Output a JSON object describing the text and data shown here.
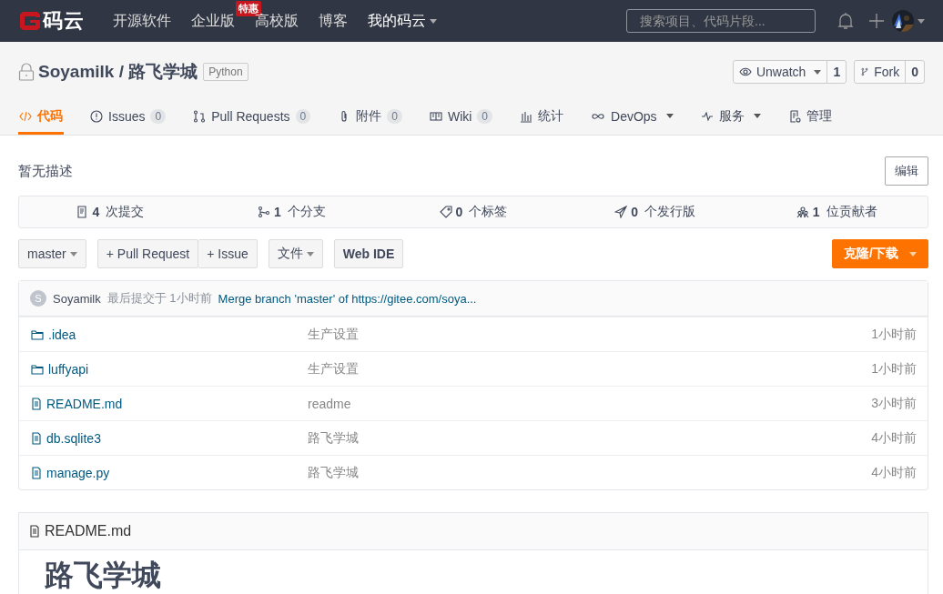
{
  "header": {
    "logo_text": "码云",
    "nav": [
      {
        "label": "开源软件"
      },
      {
        "label": "企业版",
        "badge": "特惠"
      },
      {
        "label": "高校版"
      },
      {
        "label": "博客"
      },
      {
        "label": "我的码云",
        "dropdown": true
      }
    ],
    "search": {
      "placeholder": "搜索项目、代码片段..."
    }
  },
  "repo": {
    "owner_path": "Soyamilk / 路飞学城",
    "language": "Python",
    "watch": {
      "label": "Unwatch",
      "count": "1"
    },
    "fork": {
      "label": "Fork",
      "count": "0"
    }
  },
  "tabs": [
    {
      "kind": "code",
      "label": "代码",
      "selected": true
    },
    {
      "kind": "issues",
      "label": "Issues",
      "count": "0",
      "selected": false
    },
    {
      "kind": "pr",
      "label": "Pull Requests",
      "count": "0",
      "selected": false
    },
    {
      "kind": "attach",
      "label": "附件",
      "count": "0",
      "selected": false
    },
    {
      "kind": "wiki",
      "label": "Wiki",
      "count": "0",
      "selected": false
    },
    {
      "kind": "stats",
      "label": "统计",
      "selected": false
    },
    {
      "kind": "devops",
      "label": "DevOps",
      "dropdown": true,
      "selected": false
    },
    {
      "kind": "service",
      "label": "服务",
      "dropdown": true,
      "selected": false
    },
    {
      "kind": "manage",
      "label": "管理",
      "selected": false
    }
  ],
  "description": "暂无描述",
  "edit_button": "编辑",
  "stats": [
    {
      "kind": "commits",
      "count": "4",
      "label": "次提交"
    },
    {
      "kind": "branches",
      "count": "1",
      "label": "个分支"
    },
    {
      "kind": "tags",
      "count": "0",
      "label": "个标签"
    },
    {
      "kind": "releases",
      "count": "0",
      "label": "个发行版"
    },
    {
      "kind": "contributors",
      "count": "1",
      "label": "位贡献者"
    }
  ],
  "toolbar": {
    "branch": "master",
    "pull_request": "+ Pull Request",
    "issue": "+ Issue",
    "files": "文件",
    "web_ide": "Web IDE",
    "clone": "克隆/下载"
  },
  "last_commit": {
    "avatar_letter": "S",
    "author": "Soyamilk",
    "meta": "最后提交于 1小时前",
    "message": "Merge branch 'master' of https://gitee.com/soya..."
  },
  "files": [
    {
      "kind": "folder",
      "name": ".idea",
      "message": "生产设置",
      "time": "1小时前"
    },
    {
      "kind": "folder",
      "name": "luffyapi",
      "message": "生产设置",
      "time": "1小时前"
    },
    {
      "kind": "file",
      "name": "README.md",
      "message": "readme",
      "time": "3小时前"
    },
    {
      "kind": "file",
      "name": "db.sqlite3",
      "message": "路飞学城",
      "time": "4小时前"
    },
    {
      "kind": "file",
      "name": "manage.py",
      "message": "路飞学城",
      "time": "4小时前"
    }
  ],
  "readme": {
    "filename": "README.md",
    "heading": "路飞学城"
  }
}
